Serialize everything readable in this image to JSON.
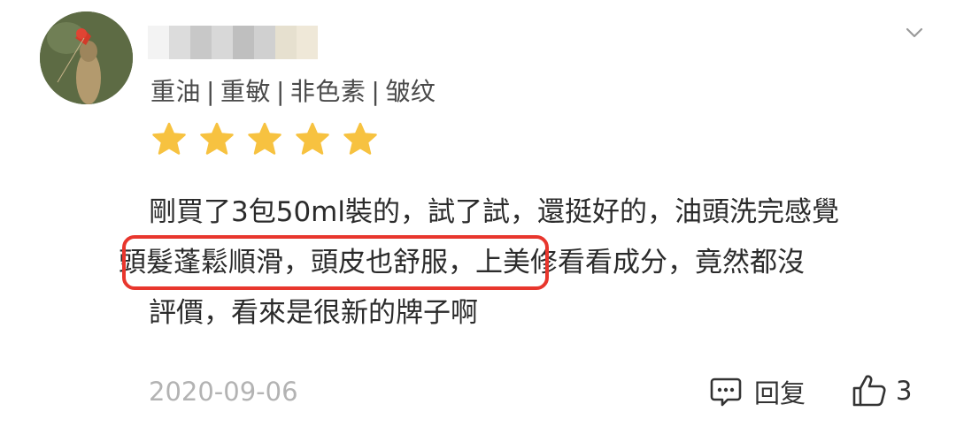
{
  "review": {
    "tags": [
      "重油",
      "重敏",
      "非色素",
      "皱纹"
    ],
    "tag_separator": "|",
    "rating": 5,
    "text_lines": [
      "剛買了3包50ml裝的，試了試，還挺好的，油頭洗完感覺",
      "頭髮蓬鬆順滑，頭皮也舒服，上美修看看成分，竟然都沒",
      "評價，看來是很新的牌子啊"
    ],
    "highlighted_text": "頭髮蓬鬆順滑，頭皮也舒服，",
    "after_highlight_text": "上美修看看成分，竟然都沒",
    "date": "2020-09-06"
  },
  "actions": {
    "reply_label": "回复",
    "like_count": "3"
  },
  "colors": {
    "star": "#f7c240",
    "highlight_border": "#e8362d",
    "date": "#b3b3b3"
  },
  "icons": {
    "avatar": "avatar-image",
    "dropdown": "chevron-down-icon",
    "reply": "comment-icon",
    "like": "thumbs-up-icon"
  }
}
